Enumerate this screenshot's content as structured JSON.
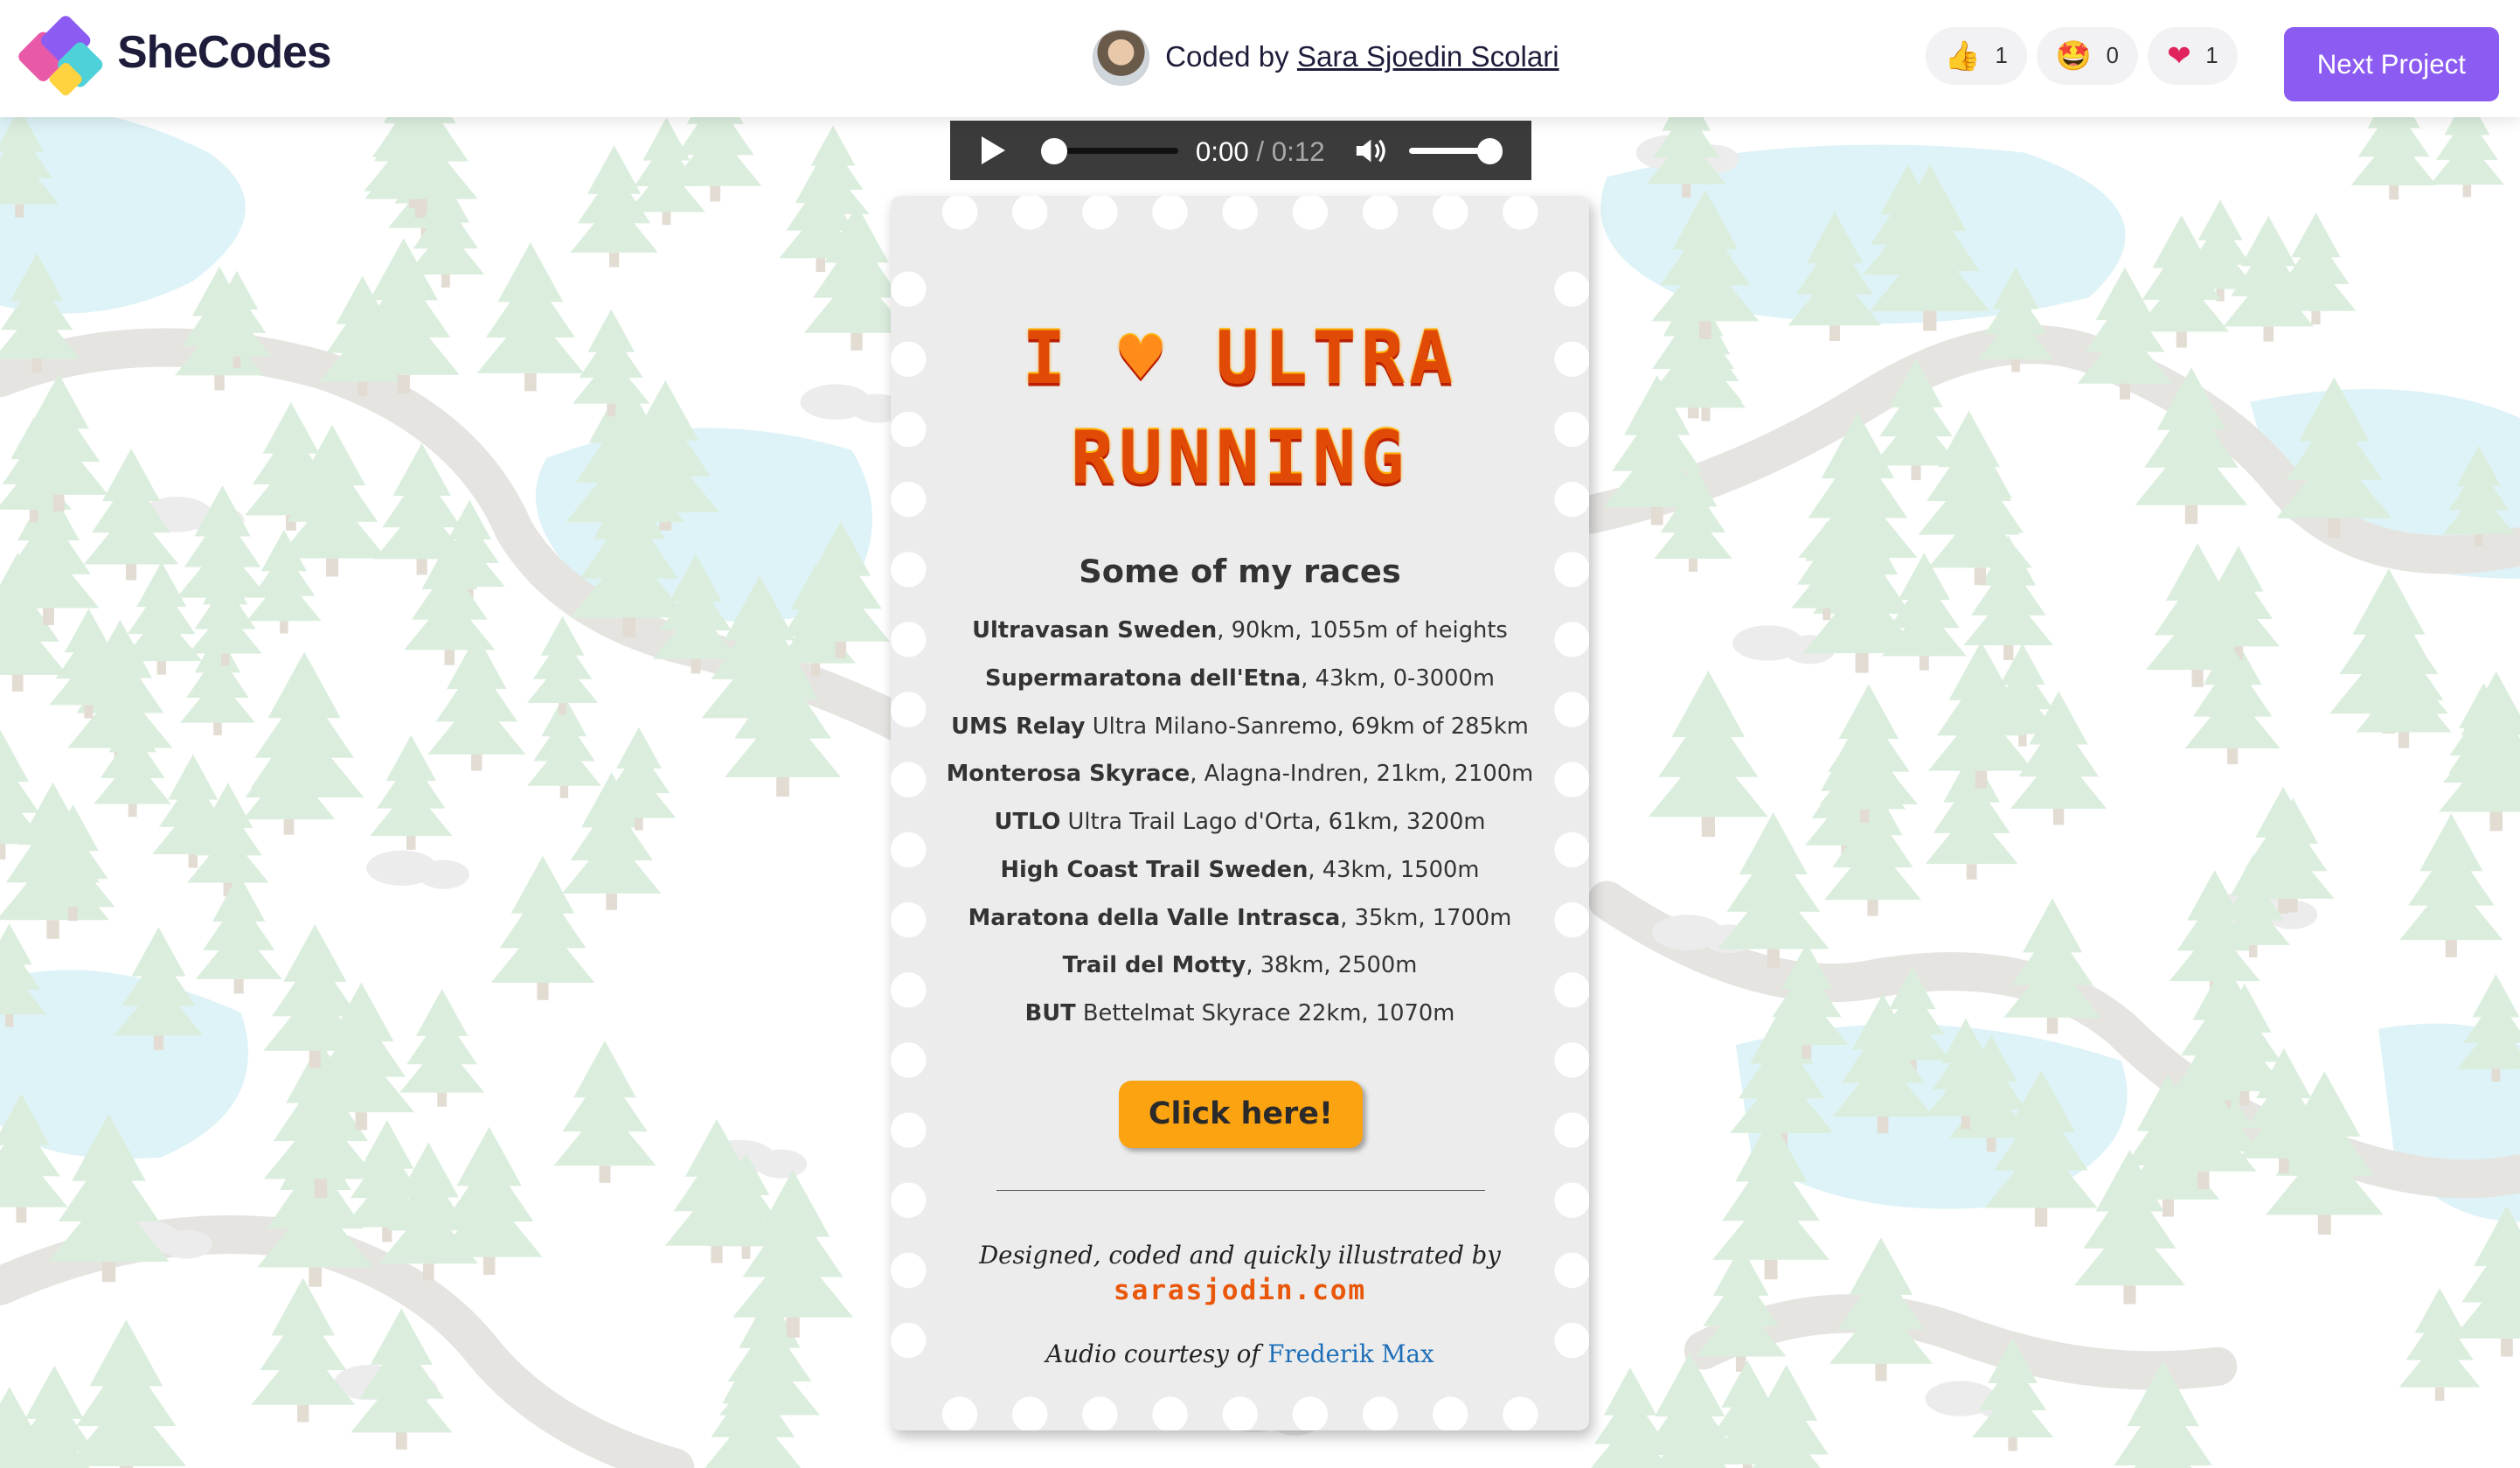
{
  "header": {
    "brand": "SheCodes",
    "coded_by_prefix": "Coded by",
    "author": "Sara Sjoedin Scolari",
    "reactions": [
      {
        "icon": "thumbs-up",
        "count": "1"
      },
      {
        "icon": "star-struck",
        "count": "0"
      },
      {
        "icon": "heart",
        "count": "1"
      }
    ],
    "next_button": "Next Project"
  },
  "audio": {
    "current_time": "0:00",
    "duration": "/ 0:12"
  },
  "card": {
    "title_line1_a": "I",
    "title_heart": "♥",
    "title_line1_b": "ULTRA",
    "title_line2": "RUNNING",
    "subtitle": "Some of my races",
    "races": [
      {
        "name": "Ultravasan Sweden",
        "details": ", 90km, 1055m of heights"
      },
      {
        "name": "Supermaratona dell'Etna",
        "details": ", 43km, 0-3000m"
      },
      {
        "name": "UMS Relay",
        "details": " Ultra Milano-Sanremo, 69km of 285km"
      },
      {
        "name": "Monterosa Skyrace",
        "details": ", Alagna-Indren, 21km, 2100m"
      },
      {
        "name": "UTLO",
        "details": " Ultra Trail Lago d'Orta, 61km, 3200m"
      },
      {
        "name": "High Coast Trail Sweden",
        "details": ", 43km, 1500m"
      },
      {
        "name": "Maratona della Valle Intrasca",
        "details": ", 35km, 1700m"
      },
      {
        "name": "Trail del Motty",
        "details": ", 38km, 2500m"
      },
      {
        "name": "BUT",
        "details": " Bettelmat Skyrace 22km, 1070m"
      }
    ],
    "cta_label": "Click here!",
    "credit": "Designed, coded and quickly illustrated by",
    "site": "sarasjodin.com",
    "audio_credit_prefix": "Audio courtesy of",
    "audio_credit_link": "Frederik Max"
  },
  "colors": {
    "accent": "#8c5cf2",
    "title_orange": "#e04a06",
    "cta": "#fca311",
    "player": "#3b3b3b"
  }
}
